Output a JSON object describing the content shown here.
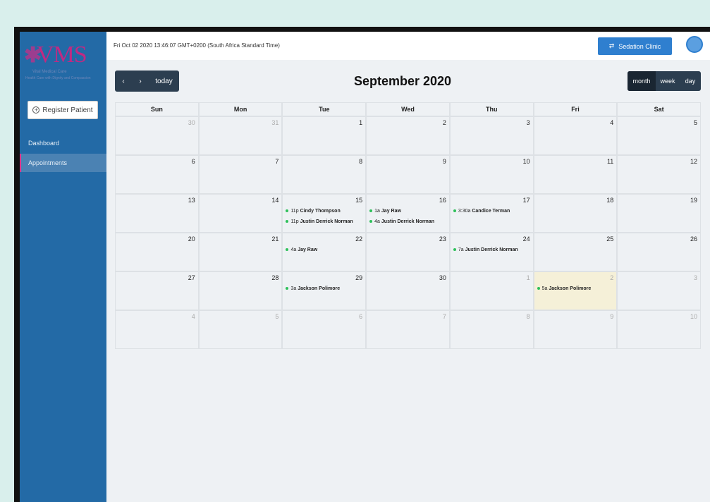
{
  "brand": {
    "logo_text": "VMS",
    "subtitle": "Vital Medical Care",
    "tagline": "Health Care with Dignity and Compassion"
  },
  "sidebar": {
    "register_label": "Register Patient",
    "items": [
      {
        "label": "Dashboard",
        "active": false
      },
      {
        "label": "Appointments",
        "active": true
      }
    ]
  },
  "topbar": {
    "datetime": "Fri Oct 02 2020 13:46:07 GMT+0200 (South Africa Standard Time)",
    "clinic_label": "Sedation Clinic"
  },
  "calendar": {
    "title": "September 2020",
    "today_label": "today",
    "views": [
      "month",
      "week",
      "day"
    ],
    "active_view": "month",
    "day_headers": [
      "Sun",
      "Mon",
      "Tue",
      "Wed",
      "Thu",
      "Fri",
      "Sat"
    ],
    "weeks": [
      [
        {
          "n": "30",
          "other": true
        },
        {
          "n": "31",
          "other": true
        },
        {
          "n": "1"
        },
        {
          "n": "2"
        },
        {
          "n": "3"
        },
        {
          "n": "4"
        },
        {
          "n": "5"
        }
      ],
      [
        {
          "n": "6"
        },
        {
          "n": "7"
        },
        {
          "n": "8"
        },
        {
          "n": "9"
        },
        {
          "n": "10"
        },
        {
          "n": "11"
        },
        {
          "n": "12"
        }
      ],
      [
        {
          "n": "13"
        },
        {
          "n": "14"
        },
        {
          "n": "15",
          "events": [
            {
              "time": "11p",
              "name": "Cindy Thompson"
            },
            {
              "time": "11p",
              "name": "Justin Derrick Norman"
            }
          ]
        },
        {
          "n": "16",
          "events": [
            {
              "time": "1a",
              "name": "Jay Raw"
            },
            {
              "time": "4a",
              "name": "Justin Derrick Norman"
            }
          ]
        },
        {
          "n": "17",
          "events": [
            {
              "time": "3:30a",
              "name": "Candice Terman"
            }
          ]
        },
        {
          "n": "18"
        },
        {
          "n": "19"
        }
      ],
      [
        {
          "n": "20"
        },
        {
          "n": "21"
        },
        {
          "n": "22",
          "events": [
            {
              "time": "4a",
              "name": "Jay Raw"
            }
          ]
        },
        {
          "n": "23"
        },
        {
          "n": "24",
          "events": [
            {
              "time": "7a",
              "name": "Justin Derrick Norman"
            }
          ]
        },
        {
          "n": "25"
        },
        {
          "n": "26"
        }
      ],
      [
        {
          "n": "27"
        },
        {
          "n": "28"
        },
        {
          "n": "29",
          "events": [
            {
              "time": "3a",
              "name": "Jackson Polimore"
            }
          ]
        },
        {
          "n": "30"
        },
        {
          "n": "1",
          "other": true
        },
        {
          "n": "2",
          "other": true,
          "today": true,
          "events": [
            {
              "time": "5a",
              "name": "Jackson Polimore"
            }
          ]
        },
        {
          "n": "3",
          "other": true
        }
      ],
      [
        {
          "n": "4",
          "other": true
        },
        {
          "n": "5",
          "other": true
        },
        {
          "n": "6",
          "other": true
        },
        {
          "n": "7",
          "other": true
        },
        {
          "n": "8",
          "other": true
        },
        {
          "n": "9",
          "other": true
        },
        {
          "n": "10",
          "other": true
        }
      ]
    ]
  },
  "colors": {
    "sidebar": "#236aa6",
    "accent": "#2f7fcf",
    "event_dot": "#2ec05a",
    "today_cell": "#f5f0d8"
  }
}
